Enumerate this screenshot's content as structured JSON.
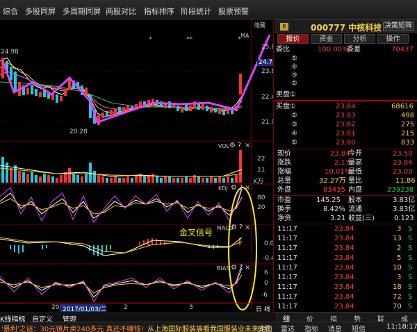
{
  "menu": [
    "综合",
    "多股同屏",
    "多周期同屏",
    "两股对比",
    "指标排序",
    "阶段统计",
    "股票预警"
  ],
  "chart": {
    "hide_label": "隐藏",
    "price_labels": [
      "25.8",
      "24.71",
      "23.8",
      "22.4",
      "21.0"
    ],
    "kline_hi_label": "24.98",
    "kline_lo_label": "20.28",
    "stars": [
      "*",
      "**",
      "*"
    ],
    "ma_tag": "MA",
    "vol_tag": "VOL",
    "vol_labels": [
      "22",
      "11"
    ],
    "vol_unit": "X万",
    "kdj_tag": "KDJ",
    "kdj_labels": [
      "80",
      "20"
    ],
    "macd_tag": "MACD",
    "macd_labels": [
      "0.0",
      "-0.4"
    ],
    "bias_tag": "BIAS",
    "bias_labels": [
      "6",
      "0",
      "-6"
    ],
    "annotation": "金叉信号",
    "icons": [
      "gear",
      "?",
      "×"
    ]
  },
  "date_axis": {
    "labels": [
      "20",
      "2017/01/03/二",
      "2",
      "3"
    ],
    "day_label": "日",
    "line_label": "线"
  },
  "bottom_tabs": [
    "K线指标",
    "自定义",
    "管理"
  ],
  "status": {
    "left": "'暴利'之谜：30元镜片卖240多元 真还不赚钱!",
    "marquee": "从上海国际服装展看我国服装业未来走向",
    "items": [
      "日程",
      "雷达",
      "指标",
      "消息",
      "短信"
    ],
    "time": "11:18:17"
  },
  "stock": {
    "badge": "R",
    "code": "000777",
    "name": "中核科技",
    "title": "000777 中核科技",
    "button": "决策矩阵",
    "tabs": [
      "报价",
      "资金",
      "分析",
      "操作"
    ],
    "ratio_label": "委比",
    "ratio_value": "100.00%",
    "diff_label": "委差",
    "diff_value": "70437",
    "sell_orders": [
      {
        "label": "⑤",
        "price": "",
        "vol": ""
      },
      {
        "label": "④",
        "price": "",
        "vol": ""
      },
      {
        "label": "③",
        "price": "",
        "vol": ""
      },
      {
        "label": "②",
        "price": "",
        "vol": ""
      },
      {
        "label": "卖盘①",
        "price": "",
        "vol": ""
      }
    ],
    "buy_orders": [
      {
        "label": "买盘①",
        "price": "23.84",
        "vol": "68616"
      },
      {
        "label": "②",
        "price": "23.83",
        "vol": "498"
      },
      {
        "label": "③",
        "price": "23.82",
        "vol": "275"
      },
      {
        "label": "④",
        "price": "23.81",
        "vol": "215"
      },
      {
        "label": "⑤",
        "price": "23.80",
        "vol": "833"
      }
    ],
    "quote": [
      {
        "l1": "现价",
        "v1": "23.84",
        "c1": "red",
        "l2": "今开",
        "v2": "23.50",
        "c2": "red"
      },
      {
        "l1": "涨跌",
        "v1": "2.17",
        "c1": "red",
        "l2": "最高",
        "v2": "23.84",
        "c2": "red"
      },
      {
        "l1": "涨幅",
        "v1": "10.01%",
        "c1": "red",
        "l2": "最低",
        "v2": "23.00",
        "c2": "red"
      },
      {
        "l1": "总量",
        "v1": "32.27万",
        "c1": "yellow",
        "l2": "量比",
        "v2": "11.86",
        "c2": "yellow"
      },
      {
        "l1": "外盘",
        "v1": "83435",
        "c1": "red",
        "l2": "内盘",
        "v2": "239238",
        "c2": "green"
      },
      {
        "l1": "市盈",
        "v1": "145.25",
        "c1": "white",
        "l2": "股本",
        "v2": "3.83亿",
        "c2": "white"
      },
      {
        "l1": "换手",
        "v1": "8.42%",
        "c1": "white",
        "l2": "流通",
        "v2": "3.83亿",
        "c2": "white"
      },
      {
        "l1": "净资",
        "v1": "3.21",
        "c1": "white",
        "l2": "收益(三)",
        "v2": "0.123",
        "c2": "white"
      }
    ],
    "ticks": [
      {
        "time": "11:17",
        "price": "23.84",
        "vol": "3",
        "dir": "S"
      },
      {
        "time": "11:17",
        "price": "23.84",
        "vol": "13",
        "dir": "S"
      },
      {
        "time": "11:17",
        "price": "23.84",
        "vol": "2",
        "dir": "S"
      },
      {
        "time": "11:17",
        "price": "23.84",
        "vol": "5",
        "dir": "S"
      },
      {
        "time": "11:17",
        "price": "23.84",
        "vol": "10",
        "dir": "S"
      },
      {
        "time": "11:17",
        "price": "23.84",
        "vol": "3",
        "dir": "S"
      },
      {
        "time": "11:17",
        "price": "23.84",
        "vol": "18",
        "dir": "S"
      },
      {
        "time": "11:17",
        "price": "23.84",
        "vol": "72",
        "dir": "S"
      },
      {
        "time": "11:17",
        "price": "23.84",
        "vol": "70",
        "dir": "S"
      }
    ],
    "bottom_tabs": [
      "细",
      "价",
      "指",
      "势",
      "联",
      "成"
    ]
  }
}
